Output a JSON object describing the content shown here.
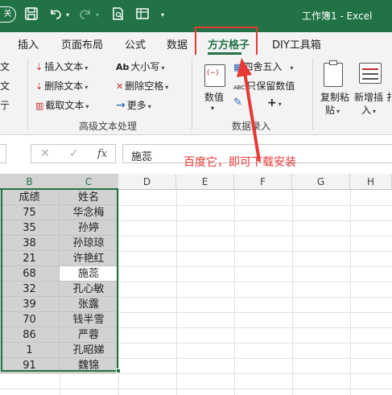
{
  "titlebar": {
    "autosave_label": "关",
    "save_icon": "save-icon",
    "undo_icon": "undo-icon",
    "redo_icon": "redo-icon",
    "workbook_title": "工作簿1 - Excel"
  },
  "tabs": [
    {
      "label": "插入"
    },
    {
      "label": "页面布局"
    },
    {
      "label": "公式"
    },
    {
      "label": "数据"
    },
    {
      "label": "方方格子",
      "active": true
    },
    {
      "label": "DIY工具箱"
    }
  ],
  "ribbon": {
    "left_partial": [
      "文",
      "文",
      "亍"
    ],
    "text_group": {
      "insert_text": "插入文本",
      "delete_text": "删除文本",
      "extract_text": "截取文本",
      "case": "大小写",
      "delete_space": "删除空格",
      "more": "更多",
      "group_label": "高级文本处理",
      "case_icon_text": "Ab"
    },
    "number_group": {
      "value_label": "数值",
      "round_label": "四舍五入",
      "keep_value_label": "只保留数值",
      "plus_label": "+",
      "group_label": "数据录入",
      "abc_icon_text": "ABC"
    },
    "copy_paste": {
      "line1": "复制粘",
      "line2": "贴"
    },
    "new_insert": {
      "line1": "新增插",
      "line2": "入"
    },
    "edge_label": "扌"
  },
  "formula_bar": {
    "cancel": "✕",
    "confirm": "✓",
    "fx": "fx",
    "content": "施蕊"
  },
  "annotation": "百度它，即可下载安装",
  "columns": [
    "B",
    "C",
    "D",
    "E",
    "F",
    "G",
    "H"
  ],
  "table": {
    "headers": [
      "成绩",
      "姓名"
    ],
    "rows": [
      [
        "75",
        "华念梅"
      ],
      [
        "35",
        "孙婷"
      ],
      [
        "38",
        "孙琼琼"
      ],
      [
        "21",
        "许艳红"
      ],
      [
        "68",
        "施蕊"
      ],
      [
        "32",
        "孔心敏"
      ],
      [
        "39",
        "张露"
      ],
      [
        "70",
        "钱半雪"
      ],
      [
        "86",
        "严蓉"
      ],
      [
        "1",
        "孔昭娣"
      ],
      [
        "91",
        "魏锦"
      ]
    ]
  },
  "colors": {
    "excel_green": "#217346",
    "annotation_red": "#e53935",
    "selected_fill": "#d2d2d2"
  }
}
